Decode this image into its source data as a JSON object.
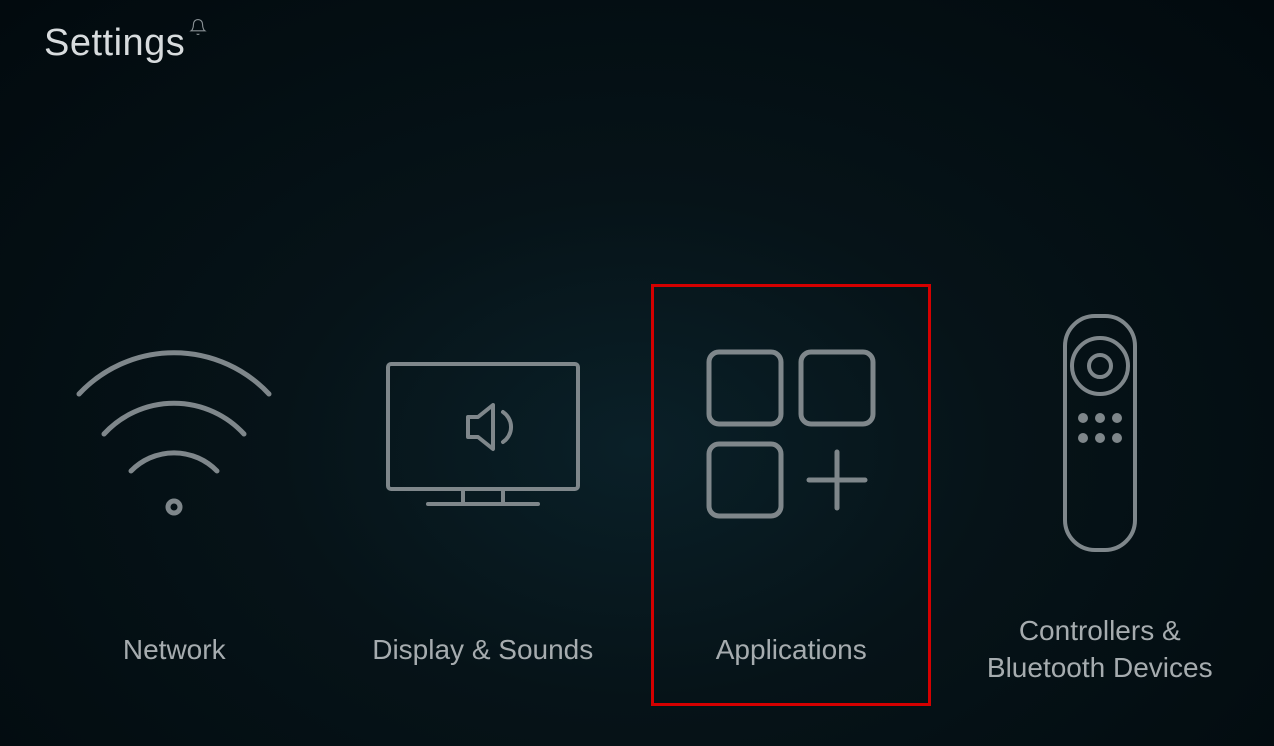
{
  "header": {
    "title": "Settings"
  },
  "tiles": [
    {
      "id": "network",
      "label": "Network",
      "icon": "wifi-icon",
      "highlighted": false
    },
    {
      "id": "display-sounds",
      "label": "Display & Sounds",
      "icon": "tv-sound-icon",
      "highlighted": false
    },
    {
      "id": "applications",
      "label": "Applications",
      "icon": "apps-grid-icon",
      "highlighted": true
    },
    {
      "id": "controllers-bluetooth",
      "label": "Controllers &\nBluetooth Devices",
      "icon": "remote-icon",
      "highlighted": false
    }
  ]
}
